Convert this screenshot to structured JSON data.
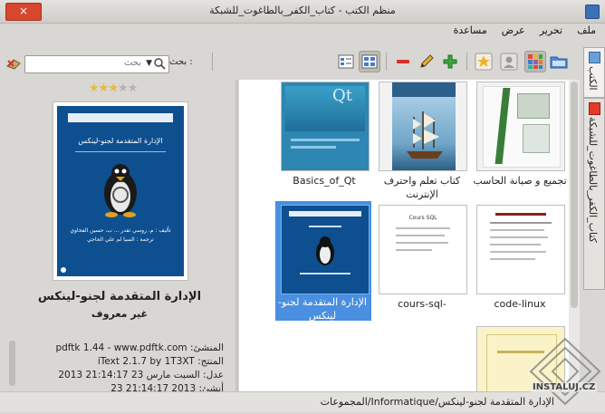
{
  "window": {
    "title": "منظم الكتب - كتاب_الكفر_بالطاغوت_للشبكة",
    "close_label": "×"
  },
  "menu": [
    "ملف",
    "تحرير",
    "عرض",
    "مساعدة"
  ],
  "search": {
    "label": "بحث :",
    "placeholder": "بحث"
  },
  "book": {
    "rating": 3,
    "rating_max": 5,
    "title": "الإدارة المتقدمة لجنو-لينكس",
    "author": "غير معروف",
    "cover": {
      "heading": "الإدارة المتقدمة لجنو-لينكس",
      "line1": "تأليف : م. روسي تفدر ... ب. حسين الفخاوي",
      "line2": "ترجمة : السيا لم علي الحاجي"
    },
    "meta": [
      {
        "key": "المنشئ:",
        "value": "pdftk 1.44 - www.pdftk.com"
      },
      {
        "key": "المنتج:",
        "value": "iText 2.1.7 by 1T3XT"
      },
      {
        "key": "عدل:",
        "value": "السبت مارس 23 21:14:17 2013"
      },
      {
        "key": "أنشئ:",
        "value": "2013 21:14:17 23"
      }
    ]
  },
  "grid": {
    "items": [
      {
        "label": "تجميع و صيانة الحاسب"
      },
      {
        "label": "كتاب تعلم واحترف الإنترنت"
      },
      {
        "label": "Basics_of_Qt",
        "thumb_text": "Qt"
      },
      {
        "label": "code-linux"
      },
      {
        "label": "-cours-sql",
        "thumb_text": "Cours SQL"
      },
      {
        "label": "الإدارة المتقدمة لجنو-لينكس",
        "selected": true
      },
      {
        "label": ""
      }
    ]
  },
  "tabs": [
    {
      "label": "الكتب"
    },
    {
      "label": "كتاب_الكفر_بالطاغوت_للشبكة"
    }
  ],
  "status": "المجموعات/Informatique/الإدارة المتقدمة لجنو-لينكس",
  "watermark": "INSTALUJ.CZ"
}
